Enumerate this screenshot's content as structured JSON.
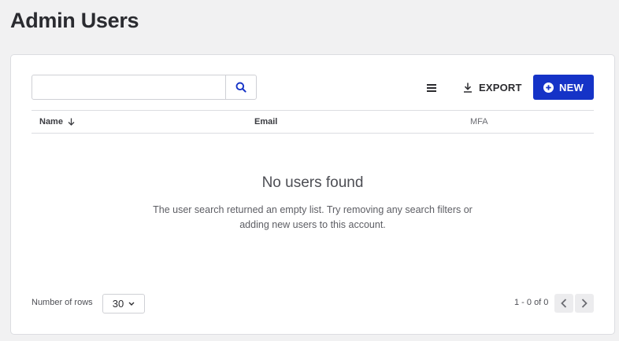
{
  "page": {
    "title": "Admin Users"
  },
  "search": {
    "value": "",
    "placeholder": "",
    "button_icon": "search-icon"
  },
  "toolbar": {
    "density_icon": "list-density-icon",
    "export_label": "EXPORT",
    "export_icon": "download-icon",
    "new_label": "NEW",
    "new_icon": "plus-circle-icon"
  },
  "table": {
    "columns": [
      {
        "label": "Name",
        "sort": "descending"
      },
      {
        "label": "Email"
      },
      {
        "label": "MFA"
      }
    ],
    "rows": []
  },
  "empty_state": {
    "title": "No users found",
    "description": "The user search returned an empty list. Try removing any search filters or adding new users to this account."
  },
  "footer": {
    "rows_label": "Number of rows",
    "rows_value": "30",
    "page_info": "1 - 0 of 0"
  },
  "colors": {
    "primary": "#1533c7",
    "background": "#f1f1f2",
    "card": "#ffffff"
  }
}
